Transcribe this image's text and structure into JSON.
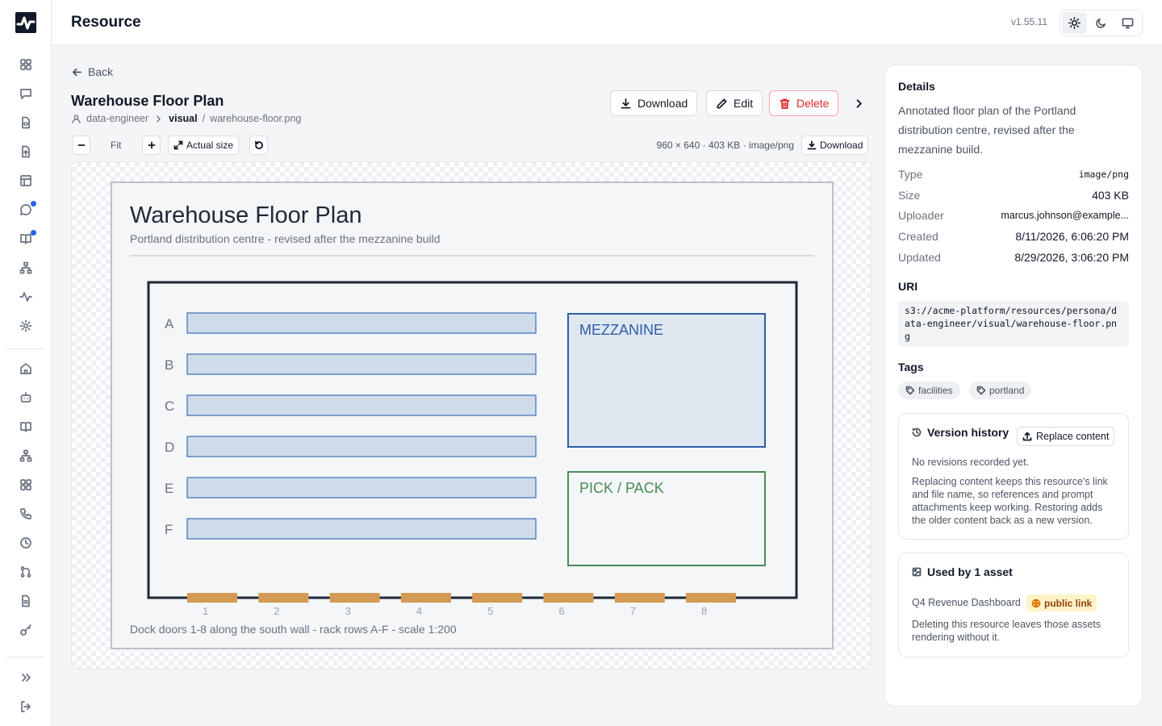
{
  "header": {
    "title": "Resource",
    "version": "v1.55.11"
  },
  "nav": {
    "back_label": "Back"
  },
  "resource": {
    "title": "Warehouse Floor Plan",
    "breadcrumb": {
      "owner": "data-engineer",
      "folder": "visual",
      "file": "warehouse-floor.png"
    }
  },
  "actions": {
    "download": "Download",
    "edit": "Edit",
    "delete": "Delete"
  },
  "viewer_toolbar": {
    "fit": "Fit",
    "actual_size": "Actual size",
    "meta": "960 × 640 · 403 KB · image/png",
    "download": "Download"
  },
  "image": {
    "title": "Warehouse Floor Plan",
    "subtitle": "Portland distribution centre - revised after the mezzanine build",
    "rows": [
      "A",
      "B",
      "C",
      "D",
      "E",
      "F"
    ],
    "mezzanine_label": "MEZZANINE",
    "pick_pack_label": "PICK / PACK",
    "doors": [
      "1",
      "2",
      "3",
      "4",
      "5",
      "6",
      "7",
      "8"
    ],
    "caption": "Dock doors 1-8 along the south wall - rack rows A-F - scale 1:200",
    "colors": {
      "rack": "#cfdcea",
      "rack_stroke": "#3b6db5",
      "mezz_stroke": "#2d5ea8",
      "pick_stroke": "#4a8c55",
      "door": "#d49a55",
      "wall": "#1f2937"
    }
  },
  "details": {
    "heading": "Details",
    "description": "Annotated floor plan of the Portland distribution centre, revised after the mezzanine build.",
    "type_label": "Type",
    "type": "image/png",
    "size_label": "Size",
    "size": "403 KB",
    "uploader_label": "Uploader",
    "uploader": "marcus.johnson@example...",
    "created_label": "Created",
    "created": "8/11/2026, 6:06:20 PM",
    "updated_label": "Updated",
    "updated": "8/29/2026, 3:06:20 PM",
    "uri_heading": "URI",
    "uri": "s3://acme-platform/resources/persona/data-engineer/visual/warehouse-floor.png",
    "tags_heading": "Tags",
    "tags": [
      "facilities",
      "portland"
    ]
  },
  "version_history": {
    "heading": "Version history",
    "replace_label": "Replace content",
    "empty": "No revisions recorded yet.",
    "note": "Replacing content keeps this resource's link and file name, so references and prompt attachments keep working. Restoring adds the older content back as a new version."
  },
  "used_by": {
    "heading": "Used by 1 asset",
    "asset": "Q4 Revenue Dashboard",
    "badge": "public link",
    "note": "Deleting this resource leaves those assets rendering without it."
  },
  "icons": {
    "sidebar": [
      "grid-icon",
      "message-icon",
      "code-file-icon",
      "file-upload-icon",
      "table-icon",
      "chat-icon",
      "book-icon",
      "org-icon",
      "activity-icon",
      "gear-icon",
      "home-icon",
      "bot-icon",
      "docs-icon",
      "network-icon",
      "apps-icon",
      "phone-icon",
      "clock-icon",
      "merge-icon",
      "document-icon",
      "key-icon",
      "expand-icon",
      "logout-icon"
    ],
    "theme": [
      "sun-icon",
      "moon-icon",
      "monitor-icon"
    ],
    "accent": "#2563eb"
  }
}
